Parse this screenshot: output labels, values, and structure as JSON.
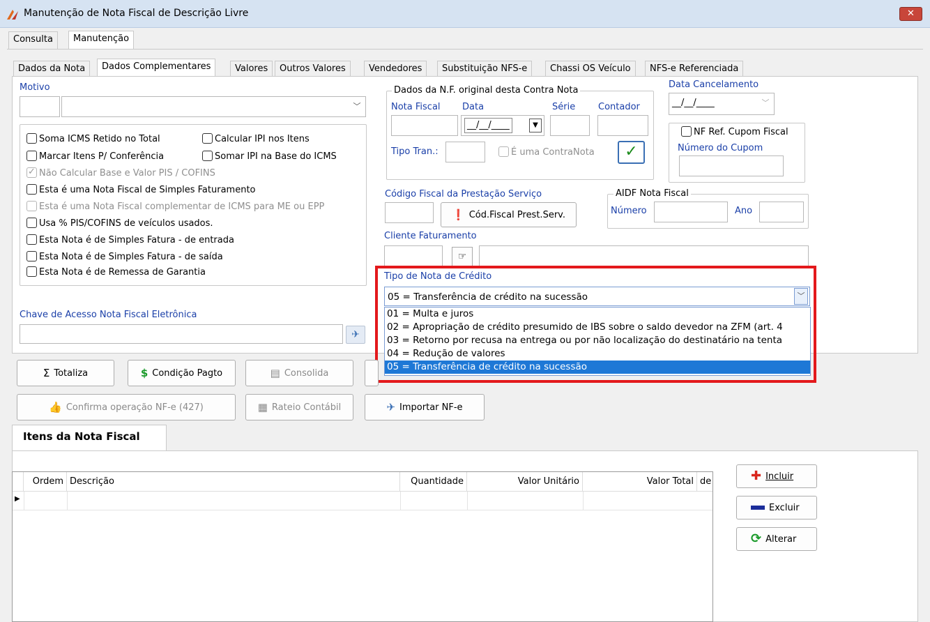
{
  "window": {
    "title": "Manutenção de Nota Fiscal de Descrição Livre",
    "close_glyph": "✕"
  },
  "top_tabs": [
    "Consulta",
    "Manutenção"
  ],
  "sub_tabs": [
    "Dados da Nota",
    "Dados Complementares",
    "Valores",
    "Outros Valores",
    "Vendedores",
    "Substituição NFS-e",
    "Chassi OS Veículo",
    "NFS-e Referenciada"
  ],
  "motivo": {
    "label": "Motivo",
    "code": "",
    "value": ""
  },
  "checkboxes": {
    "soma_icms": "Soma ICMS Retido no Total",
    "calc_ipi": "Calcular IPI nos Itens",
    "marcar_itens": "Marcar Itens P/ Conferência",
    "somar_ipi": "Somar IPI na Base do ICMS",
    "nao_calc_pis": "Não Calcular Base e Valor PIS / COFINS",
    "simples_fat": "Esta é uma Nota Fiscal de Simples Faturamento",
    "complementar": "Esta é uma Nota Fiscal complementar de ICMS para ME ou EPP",
    "usa_pis": "Usa % PIS/COFINS de veículos usados.",
    "simples_entrada": "Esta Nota é de Simples Fatura - de entrada",
    "simples_saida": "Esta Nota é de Simples Fatura - de saída",
    "remessa_garantia": "Esta Nota é de Remessa de Garantia"
  },
  "nf_original": {
    "legend": "Dados da N.F. original desta Contra Nota",
    "nota_fiscal": "Nota Fiscal",
    "data": "Data",
    "serie": "Série",
    "contador": "Contador",
    "data_value": "__/__/____",
    "tipo_tran": "Tipo Tran.:",
    "contranota": "É uma ContraNota"
  },
  "data_cancelamento": {
    "label": "Data Cancelamento",
    "value": "__/__/____"
  },
  "cupom": {
    "nf_ref": "NF Ref. Cupom Fiscal",
    "numero_label": "Número do Cupom"
  },
  "cod_fiscal": {
    "label": "Código Fiscal da Prestação Serviço",
    "button": "Cód.Fiscal Prest.Serv."
  },
  "aidf": {
    "legend": "AIDF Nota Fiscal",
    "numero": "Número",
    "ano": "Ano"
  },
  "cliente_faturamento": {
    "label": "Cliente Faturamento"
  },
  "tipo_credito": {
    "label": "Tipo de Nota de Crédito",
    "selected": "05 = Transferência de crédito na sucessão",
    "options": [
      "01 = Multa e juros",
      "02 = Apropriação de crédito presumido de IBS sobre o saldo devedor na ZFM (art. 4",
      "03 = Retorno por recusa na entrega ou por não localização do destinatário na tenta",
      "04 = Redução de valores",
      "05 = Transferência de crédito na sucessão"
    ]
  },
  "chave_acesso": {
    "label": "Chave de Acesso Nota Fiscal Eletrônica",
    "value": ""
  },
  "buttons": {
    "totaliza": "Totaliza",
    "condicao_pagto": "Condição Pagto",
    "consolida": "Consolida",
    "confirma_nfe": "Confirma operação NF-e (427)",
    "rateio": "Rateio Contábil",
    "importar_nfe": "Importar NF-e"
  },
  "itens": {
    "tab_label": "Itens da Nota Fiscal",
    "columns": [
      "Ordem",
      "Descrição",
      "Quantidade",
      "Valor Unitário",
      "Valor Total",
      "de"
    ],
    "incluir": "Incluir",
    "excluir": "Excluir",
    "alterar": "Alterar"
  },
  "colors": {
    "accent_blue": "#1a3fa8",
    "highlight": "#e3191c",
    "selection": "#1e78d6"
  }
}
